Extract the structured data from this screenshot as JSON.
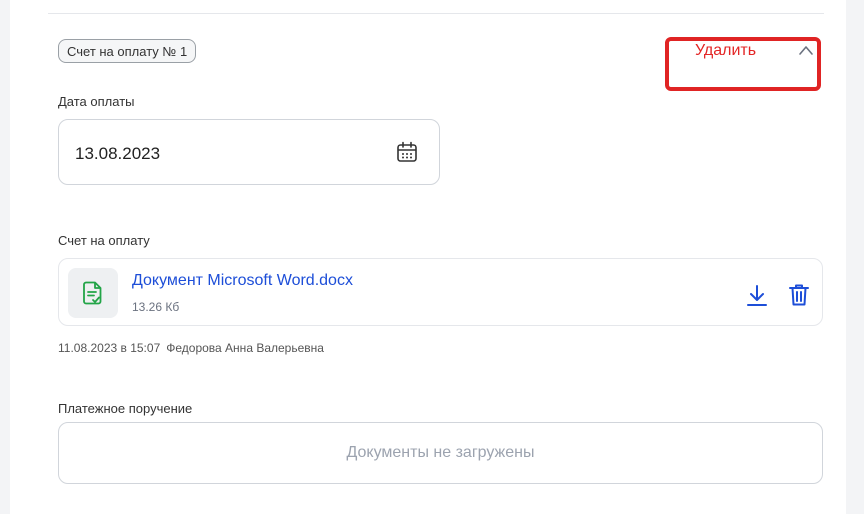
{
  "invoice_badge": "Счет на оплату № 1",
  "delete_label": "Удалить",
  "payment_date": {
    "label": "Дата оплаты",
    "value": "13.08.2023"
  },
  "invoice_section": {
    "label": "Счет на оплату",
    "file": {
      "name": "Документ Microsoft Word.docx",
      "size": "13.26 Кб"
    },
    "uploaded_at": "11.08.2023 в 15:07",
    "uploaded_by": "Федорова Анна Валерьевна"
  },
  "payment_order": {
    "label": "Платежное поручение",
    "empty_text": "Документы не загружены"
  },
  "colors": {
    "accent_blue": "#1d4ed8",
    "danger_red": "#e32525",
    "file_green": "#22a447"
  },
  "icons": [
    "chevron-up-icon",
    "calendar-icon",
    "document-icon",
    "download-icon",
    "trash-icon"
  ]
}
